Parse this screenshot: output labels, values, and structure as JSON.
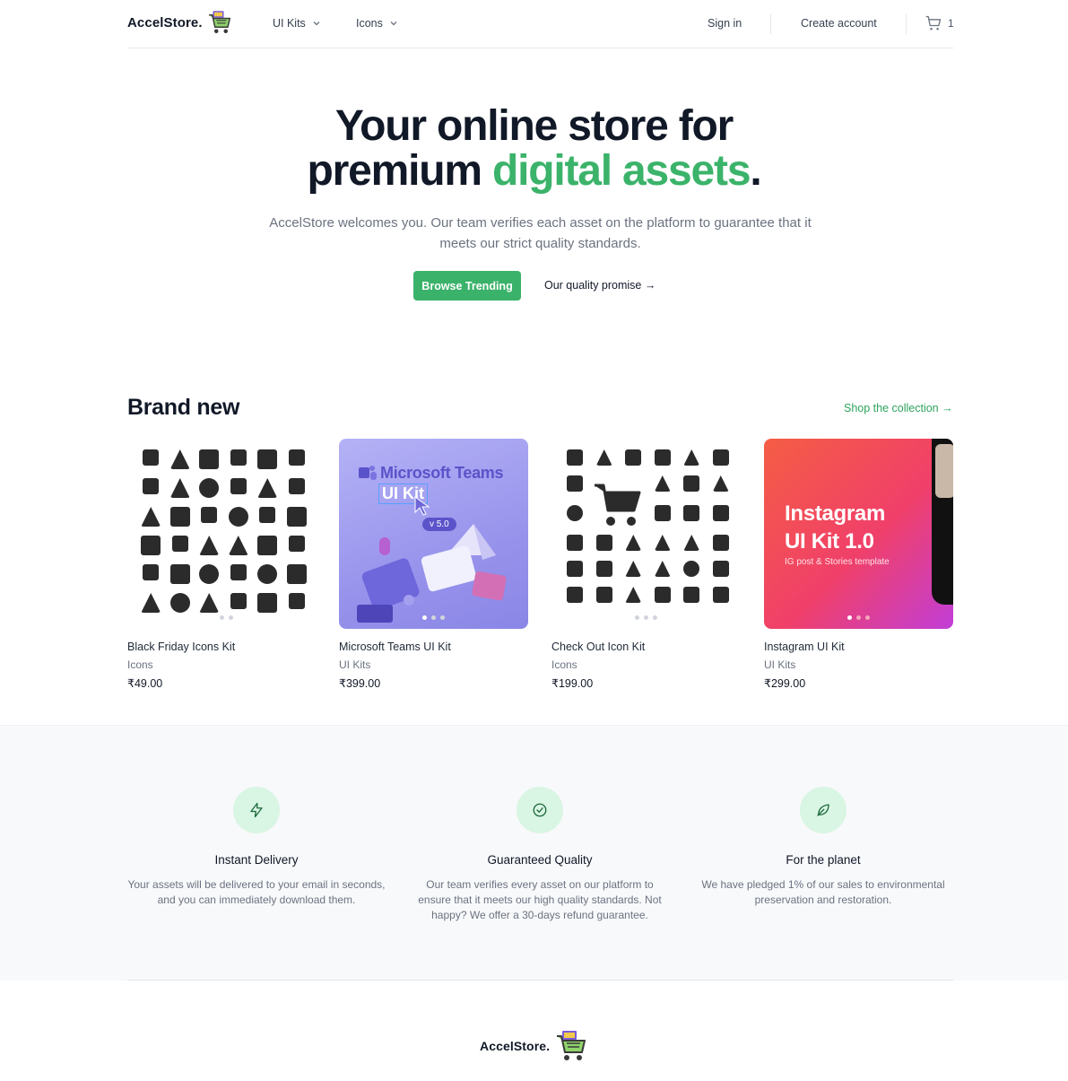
{
  "brand": {
    "name": "AccelStore.",
    "cart_icon": "shopping-cart-logo-icon"
  },
  "nav": {
    "menus": [
      {
        "label": "UI Kits"
      },
      {
        "label": "Icons"
      }
    ],
    "sign_in": "Sign in",
    "create_account": "Create account",
    "cart_count": "1"
  },
  "hero": {
    "title_line1": "Your online store for",
    "title_line2_a": "premium ",
    "title_line2_b": "digital assets",
    "title_line2_c": ".",
    "subtitle": "AccelStore welcomes you. Our team verifies each asset on the platform to guarantee that it meets our strict quality standards.",
    "primary_button": "Browse Trending",
    "secondary_link": "Our quality promise →"
  },
  "brand_new": {
    "title": "Brand new",
    "shop_link": "Shop the collection →",
    "products": [
      {
        "name": "Black Friday Icons Kit",
        "category": "Icons",
        "price": "₹49.00"
      },
      {
        "name": "Microsoft Teams UI Kit",
        "category": "UI Kits",
        "price": "₹399.00"
      },
      {
        "name": "Check Out Icon Kit",
        "category": "Icons",
        "price": "₹199.00"
      },
      {
        "name": "Instagram UI Kit",
        "category": "UI Kits",
        "price": "₹299.00"
      }
    ],
    "teams_image": {
      "title": "Microsoft Teams",
      "kit": "UI Kit",
      "version": "v 5.0"
    },
    "insta_image": {
      "title_line1": "Instagram",
      "title_line2": "UI Kit 1.0",
      "subtitle": "IG post & Stories template"
    }
  },
  "features": [
    {
      "icon": "lightning-icon",
      "title": "Instant Delivery",
      "text": "Your assets will be delivered to your email in seconds, and you can immediately download them."
    },
    {
      "icon": "check-circle-icon",
      "title": "Guaranteed Quality",
      "text": "Our team verifies every asset on our platform to ensure that it meets our high quality standards. Not happy? We offer a 30-days refund guarantee."
    },
    {
      "icon": "leaf-icon",
      "title": "For the planet",
      "text": "We have pledged 1% of our sales to environmental preservation and restoration."
    }
  ],
  "colors": {
    "accent": "#3ab26a",
    "heading": "#111827",
    "feature_bg": "#f8f9fb",
    "feature_icon_bg": "#d9f5e3"
  }
}
